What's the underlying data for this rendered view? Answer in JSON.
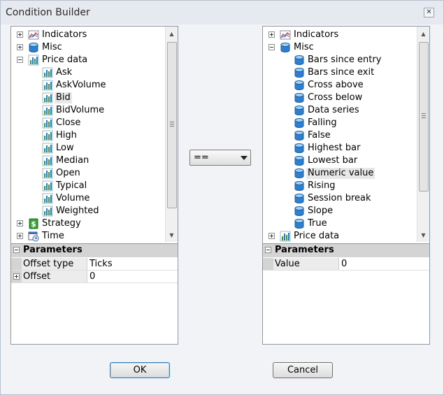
{
  "window": {
    "title": "Condition Builder"
  },
  "operator": {
    "selected": "=="
  },
  "left_tree": {
    "items": [
      {
        "label": "Indicators",
        "icon": "indicators-icon",
        "expander": "plus",
        "level": 0
      },
      {
        "label": "Misc",
        "icon": "database-icon",
        "expander": "plus",
        "level": 0
      },
      {
        "label": "Price data",
        "icon": "bar-chart-icon",
        "expander": "minus",
        "level": 0
      },
      {
        "label": "Ask",
        "icon": "bar-chart-icon",
        "level": 1
      },
      {
        "label": "AskVolume",
        "icon": "bar-chart-icon",
        "level": 1
      },
      {
        "label": "Bid",
        "icon": "bar-chart-icon",
        "level": 1,
        "selected": true
      },
      {
        "label": "BidVolume",
        "icon": "bar-chart-icon",
        "level": 1
      },
      {
        "label": "Close",
        "icon": "bar-chart-icon",
        "level": 1
      },
      {
        "label": "High",
        "icon": "bar-chart-icon",
        "level": 1
      },
      {
        "label": "Low",
        "icon": "bar-chart-icon",
        "level": 1
      },
      {
        "label": "Median",
        "icon": "bar-chart-icon",
        "level": 1
      },
      {
        "label": "Open",
        "icon": "bar-chart-icon",
        "level": 1
      },
      {
        "label": "Typical",
        "icon": "bar-chart-icon",
        "level": 1
      },
      {
        "label": "Volume",
        "icon": "bar-chart-icon",
        "level": 1
      },
      {
        "label": "Weighted",
        "icon": "bar-chart-icon",
        "level": 1
      },
      {
        "label": "Strategy",
        "icon": "dollar-icon",
        "expander": "plus",
        "level": 0
      },
      {
        "label": "Time",
        "icon": "calendar-clock-icon",
        "expander": "plus",
        "level": 0
      }
    ],
    "params_title": "Parameters",
    "params": [
      {
        "name": "Offset type",
        "value": "Ticks",
        "expander": ""
      },
      {
        "name": "Offset",
        "value": "0",
        "expander": "plus"
      }
    ]
  },
  "right_tree": {
    "items": [
      {
        "label": "Indicators",
        "icon": "indicators-icon",
        "expander": "plus",
        "level": 0
      },
      {
        "label": "Misc",
        "icon": "database-icon",
        "expander": "minus",
        "level": 0
      },
      {
        "label": "Bars since entry",
        "icon": "database-icon",
        "level": 1
      },
      {
        "label": "Bars since exit",
        "icon": "database-icon",
        "level": 1
      },
      {
        "label": "Cross above",
        "icon": "database-icon",
        "level": 1
      },
      {
        "label": "Cross below",
        "icon": "database-icon",
        "level": 1
      },
      {
        "label": "Data series",
        "icon": "database-icon",
        "level": 1
      },
      {
        "label": "Falling",
        "icon": "database-icon",
        "level": 1
      },
      {
        "label": "False",
        "icon": "database-icon",
        "level": 1
      },
      {
        "label": "Highest bar",
        "icon": "database-icon",
        "level": 1
      },
      {
        "label": "Lowest bar",
        "icon": "database-icon",
        "level": 1
      },
      {
        "label": "Numeric value",
        "icon": "database-icon",
        "level": 1,
        "selected": true
      },
      {
        "label": "Rising",
        "icon": "database-icon",
        "level": 1
      },
      {
        "label": "Session break",
        "icon": "database-icon",
        "level": 1
      },
      {
        "label": "Slope",
        "icon": "database-icon",
        "level": 1
      },
      {
        "label": "True",
        "icon": "database-icon",
        "level": 1
      },
      {
        "label": "Price data",
        "icon": "bar-chart-icon",
        "expander": "plus",
        "level": 0
      }
    ],
    "params_title": "Parameters",
    "params": [
      {
        "name": "Value",
        "value": "0",
        "expander": ""
      }
    ]
  },
  "buttons": {
    "ok": "OK",
    "cancel": "Cancel"
  },
  "colors": {
    "selection": "#e8e8e8",
    "param_header": "#d4d4d4",
    "default_button_border": "#3c7fb1"
  }
}
